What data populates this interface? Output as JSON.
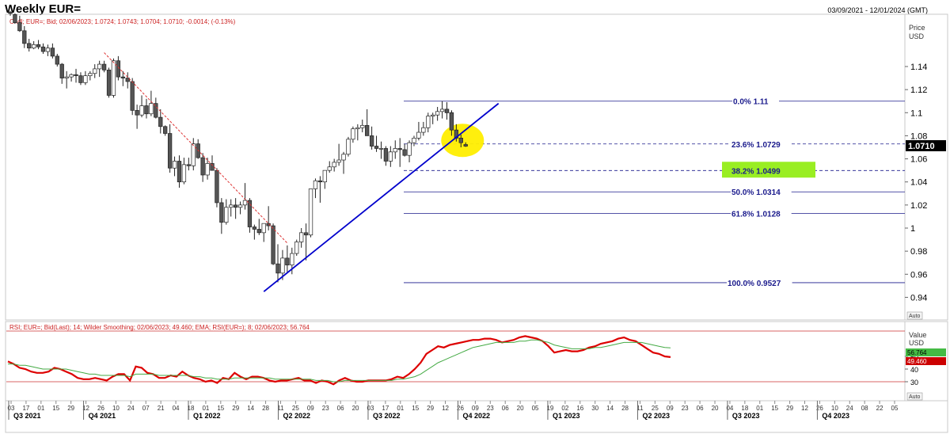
{
  "header": {
    "title": "Weekly EUR=",
    "date_range": "03/09/2021 - 12/01/2024 (GMT)"
  },
  "price_panel": {
    "legend": "Cndl; EUR=; Bid; 02/06/2023; 1.0724; 1.0743; 1.0704; 1.0710; -0.0014; (-0.13%)",
    "axis_title_1": "Price",
    "axis_title_2": "USD",
    "current_price_tag": "1.0710",
    "auto_label": "Auto"
  },
  "rsi_panel": {
    "legend": "RSI; EUR=; Bid(Last); 14; Wilder Smoothing; 02/06/2023; 49.460; EMA; RSI(EUR=); 8; 02/06/2023; 56.764",
    "axis_title_1": "Value",
    "axis_title_2": "USD",
    "ema_tag": "56.764",
    "rsi_tag": "49.460",
    "auto_label": "Auto"
  },
  "colors": {
    "up_candle": "#ffffff",
    "down_candle": "#555555",
    "fib_line": "#1a1a8c",
    "fib_text": "#1a1a8c",
    "uptrend": "#0000cc",
    "downtrend": "#dd3333",
    "highlight_circle": "#ffee00",
    "fib_box": "#99ee22",
    "rsi_line": "#dd0000",
    "ema_line": "#44aa44",
    "rsi_bound": "#cc3333",
    "price_tag_bg": "#000000",
    "ema_tag_bg": "#44bb44",
    "rsi_tag_bg": "#cc0000"
  },
  "chart_data": [
    {
      "type": "candlestick",
      "title": "Weekly EUR=",
      "ylabel": "Price USD",
      "ylim": [
        0.925,
        1.155
      ],
      "yticks": [
        0.94,
        0.96,
        0.98,
        1,
        1.02,
        1.04,
        1.06,
        1.08,
        1.1,
        1.12,
        1.14
      ],
      "ytick_labels": [
        "0.94",
        "0.96",
        "0.98",
        "1",
        "1.02",
        "1.04",
        "1.06",
        "1.08",
        "1.1",
        "1.12",
        "1.14"
      ],
      "candles": [
        {
          "o": 1.187,
          "h": 1.188,
          "l": 1.184,
          "c": 1.186
        },
        {
          "o": 1.185,
          "h": 1.186,
          "l": 1.177,
          "c": 1.178
        },
        {
          "o": 1.178,
          "h": 1.184,
          "l": 1.17,
          "c": 1.171
        },
        {
          "o": 1.171,
          "h": 1.175,
          "l": 1.156,
          "c": 1.16
        },
        {
          "o": 1.16,
          "h": 1.164,
          "l": 1.153,
          "c": 1.156
        },
        {
          "o": 1.156,
          "h": 1.162,
          "l": 1.155,
          "c": 1.159
        },
        {
          "o": 1.159,
          "h": 1.163,
          "l": 1.155,
          "c": 1.157
        },
        {
          "o": 1.157,
          "h": 1.16,
          "l": 1.151,
          "c": 1.153
        },
        {
          "o": 1.153,
          "h": 1.159,
          "l": 1.149,
          "c": 1.156
        },
        {
          "o": 1.156,
          "h": 1.16,
          "l": 1.147,
          "c": 1.149
        },
        {
          "o": 1.149,
          "h": 1.151,
          "l": 1.14,
          "c": 1.142
        },
        {
          "o": 1.142,
          "h": 1.143,
          "l": 1.125,
          "c": 1.13
        },
        {
          "o": 1.13,
          "h": 1.136,
          "l": 1.121,
          "c": 1.131
        },
        {
          "o": 1.131,
          "h": 1.134,
          "l": 1.127,
          "c": 1.133
        },
        {
          "o": 1.133,
          "h": 1.138,
          "l": 1.126,
          "c": 1.132
        },
        {
          "o": 1.132,
          "h": 1.135,
          "l": 1.124,
          "c": 1.126
        },
        {
          "o": 1.126,
          "h": 1.136,
          "l": 1.124,
          "c": 1.132
        },
        {
          "o": 1.132,
          "h": 1.136,
          "l": 1.128,
          "c": 1.134
        },
        {
          "o": 1.134,
          "h": 1.142,
          "l": 1.13,
          "c": 1.138
        },
        {
          "o": 1.138,
          "h": 1.145,
          "l": 1.131,
          "c": 1.142
        },
        {
          "o": 1.142,
          "h": 1.145,
          "l": 1.135,
          "c": 1.137
        },
        {
          "o": 1.137,
          "h": 1.139,
          "l": 1.113,
          "c": 1.115
        },
        {
          "o": 1.115,
          "h": 1.147,
          "l": 1.113,
          "c": 1.145
        },
        {
          "o": 1.145,
          "h": 1.149,
          "l": 1.128,
          "c": 1.131
        },
        {
          "o": 1.131,
          "h": 1.136,
          "l": 1.123,
          "c": 1.13
        },
        {
          "o": 1.13,
          "h": 1.135,
          "l": 1.121,
          "c": 1.127
        },
        {
          "o": 1.127,
          "h": 1.13,
          "l": 1.098,
          "c": 1.102
        },
        {
          "o": 1.102,
          "h": 1.107,
          "l": 1.086,
          "c": 1.098
        },
        {
          "o": 1.098,
          "h": 1.115,
          "l": 1.096,
          "c": 1.106
        },
        {
          "o": 1.106,
          "h": 1.112,
          "l": 1.095,
          "c": 1.099
        },
        {
          "o": 1.099,
          "h": 1.119,
          "l": 1.097,
          "c": 1.108
        },
        {
          "o": 1.108,
          "h": 1.113,
          "l": 1.095,
          "c": 1.096
        },
        {
          "o": 1.096,
          "h": 1.103,
          "l": 1.082,
          "c": 1.088
        },
        {
          "o": 1.088,
          "h": 1.089,
          "l": 1.08,
          "c": 1.082
        },
        {
          "o": 1.082,
          "h": 1.09,
          "l": 1.048,
          "c": 1.052
        },
        {
          "o": 1.052,
          "h": 1.062,
          "l": 1.045,
          "c": 1.058
        },
        {
          "o": 1.058,
          "h": 1.063,
          "l": 1.035,
          "c": 1.04
        },
        {
          "o": 1.04,
          "h": 1.061,
          "l": 1.038,
          "c": 1.055
        },
        {
          "o": 1.055,
          "h": 1.061,
          "l": 1.05,
          "c": 1.054
        },
        {
          "o": 1.054,
          "h": 1.078,
          "l": 1.05,
          "c": 1.073
        },
        {
          "o": 1.073,
          "h": 1.077,
          "l": 1.06,
          "c": 1.061
        },
        {
          "o": 1.061,
          "h": 1.065,
          "l": 1.04,
          "c": 1.046
        },
        {
          "o": 1.046,
          "h": 1.061,
          "l": 1.042,
          "c": 1.056
        },
        {
          "o": 1.056,
          "h": 1.063,
          "l": 1.05,
          "c": 1.05
        },
        {
          "o": 1.05,
          "h": 1.052,
          "l": 1.018,
          "c": 1.022
        },
        {
          "o": 1.022,
          "h": 1.026,
          "l": 0.995,
          "c": 1.005
        },
        {
          "o": 1.005,
          "h": 1.025,
          "l": 1.003,
          "c": 1.018
        },
        {
          "o": 1.018,
          "h": 1.025,
          "l": 1.01,
          "c": 1.02
        },
        {
          "o": 1.02,
          "h": 1.026,
          "l": 1.008,
          "c": 1.018
        },
        {
          "o": 1.018,
          "h": 1.023,
          "l": 1.012,
          "c": 1.02
        },
        {
          "o": 1.02,
          "h": 1.039,
          "l": 1.016,
          "c": 1.024
        },
        {
          "o": 1.024,
          "h": 1.026,
          "l": 0.996,
          "c": 1.001
        },
        {
          "o": 1.001,
          "h": 1.003,
          "l": 0.99,
          "c": 0.999
        },
        {
          "o": 0.999,
          "h": 1.008,
          "l": 0.994,
          "c": 0.996
        },
        {
          "o": 0.996,
          "h": 1.004,
          "l": 0.988,
          "c": 1.004
        },
        {
          "o": 1.004,
          "h": 1.019,
          "l": 0.998,
          "c": 1.002
        },
        {
          "o": 1.002,
          "h": 1.004,
          "l": 0.968,
          "c": 0.969
        },
        {
          "o": 0.969,
          "h": 0.986,
          "l": 0.953,
          "c": 0.961
        },
        {
          "o": 0.961,
          "h": 0.981,
          "l": 0.955,
          "c": 0.974
        },
        {
          "o": 0.974,
          "h": 0.985,
          "l": 0.962,
          "c": 0.968
        },
        {
          "o": 0.968,
          "h": 0.983,
          "l": 0.96,
          "c": 0.978
        },
        {
          "o": 0.978,
          "h": 0.99,
          "l": 0.976,
          "c": 0.988
        },
        {
          "o": 0.988,
          "h": 1.0,
          "l": 0.983,
          "c": 0.996
        },
        {
          "o": 0.996,
          "h": 1.004,
          "l": 0.972,
          "c": 0.994
        },
        {
          "o": 0.994,
          "h": 1.034,
          "l": 0.992,
          "c": 1.034
        },
        {
          "o": 1.034,
          "h": 1.043,
          "l": 1.026,
          "c": 1.041
        },
        {
          "o": 1.041,
          "h": 1.045,
          "l": 1.022,
          "c": 1.04
        },
        {
          "o": 1.04,
          "h": 1.05,
          "l": 1.034,
          "c": 1.05
        },
        {
          "o": 1.05,
          "h": 1.058,
          "l": 1.048,
          "c": 1.053
        },
        {
          "o": 1.053,
          "h": 1.06,
          "l": 1.049,
          "c": 1.057
        },
        {
          "o": 1.057,
          "h": 1.073,
          "l": 1.054,
          "c": 1.059
        },
        {
          "o": 1.059,
          "h": 1.066,
          "l": 1.047,
          "c": 1.064
        },
        {
          "o": 1.064,
          "h": 1.079,
          "l": 1.062,
          "c": 1.077
        },
        {
          "o": 1.077,
          "h": 1.088,
          "l": 1.074,
          "c": 1.086
        },
        {
          "o": 1.086,
          "h": 1.09,
          "l": 1.076,
          "c": 1.087
        },
        {
          "o": 1.087,
          "h": 1.094,
          "l": 1.083,
          "c": 1.089
        },
        {
          "o": 1.089,
          "h": 1.103,
          "l": 1.083,
          "c": 1.08
        },
        {
          "o": 1.08,
          "h": 1.088,
          "l": 1.068,
          "c": 1.071
        },
        {
          "o": 1.071,
          "h": 1.08,
          "l": 1.066,
          "c": 1.069
        },
        {
          "o": 1.069,
          "h": 1.075,
          "l": 1.06,
          "c": 1.069
        },
        {
          "o": 1.069,
          "h": 1.071,
          "l": 1.054,
          "c": 1.058
        },
        {
          "o": 1.058,
          "h": 1.071,
          "l": 1.053,
          "c": 1.066
        },
        {
          "o": 1.066,
          "h": 1.076,
          "l": 1.06,
          "c": 1.069
        },
        {
          "o": 1.069,
          "h": 1.078,
          "l": 1.053,
          "c": 1.068
        },
        {
          "o": 1.068,
          "h": 1.073,
          "l": 1.062,
          "c": 1.063
        },
        {
          "o": 1.063,
          "h": 1.076,
          "l": 1.057,
          "c": 1.074
        },
        {
          "o": 1.074,
          "h": 1.08,
          "l": 1.071,
          "c": 1.078
        },
        {
          "o": 1.078,
          "h": 1.092,
          "l": 1.076,
          "c": 1.083
        },
        {
          "o": 1.083,
          "h": 1.092,
          "l": 1.08,
          "c": 1.087
        },
        {
          "o": 1.087,
          "h": 1.1,
          "l": 1.083,
          "c": 1.097
        },
        {
          "o": 1.097,
          "h": 1.1,
          "l": 1.09,
          "c": 1.098
        },
        {
          "o": 1.098,
          "h": 1.105,
          "l": 1.093,
          "c": 1.101
        },
        {
          "o": 1.101,
          "h": 1.11,
          "l": 1.095,
          "c": 1.103
        },
        {
          "o": 1.103,
          "h": 1.109,
          "l": 1.094,
          "c": 1.1
        },
        {
          "o": 1.1,
          "h": 1.102,
          "l": 1.08,
          "c": 1.085
        },
        {
          "o": 1.085,
          "h": 1.09,
          "l": 1.075,
          "c": 1.078
        },
        {
          "o": 1.078,
          "h": 1.081,
          "l": 1.07,
          "c": 1.074
        },
        {
          "o": 1.0724,
          "h": 1.0743,
          "l": 1.0704,
          "c": 1.071
        }
      ],
      "fibonacci": [
        {
          "pct": "0.0%",
          "value": "1.11",
          "level": 1.11
        },
        {
          "pct": "23.6%",
          "value": "1.0729",
          "level": 1.0729
        },
        {
          "pct": "38.2%",
          "value": "1.0499",
          "level": 1.0499
        },
        {
          "pct": "50.0%",
          "value": "1.0314",
          "level": 1.0314
        },
        {
          "pct": "61.8%",
          "value": "1.0128",
          "level": 1.0128
        },
        {
          "pct": "100.0%",
          "value": "0.9527",
          "level": 0.9527
        }
      ],
      "downtrend_line": {
        "from": {
          "bar": 20,
          "price": 1.152
        },
        "to": {
          "bar": 59,
          "price": 0.987
        }
      },
      "uptrend_line": {
        "from": {
          "bar": 54,
          "price": 0.945
        },
        "to": {
          "bar": 104,
          "price": 1.108
        }
      },
      "highlight": {
        "bar": 96,
        "price": 1.076
      }
    },
    {
      "type": "line",
      "title": "RSI",
      "ylabel": "Value USD",
      "ylim": [
        20,
        85
      ],
      "yticks": [
        30,
        40,
        50
      ],
      "ytick_labels": [
        "30",
        "40",
        "50"
      ],
      "bounds": [
        30,
        70
      ],
      "series": [
        {
          "name": "RSI",
          "values": [
            46,
            44,
            41,
            40,
            38,
            37,
            37,
            38,
            41,
            40,
            38,
            36,
            33,
            32,
            32,
            33,
            32,
            31,
            34,
            36,
            36,
            31,
            42,
            41,
            37,
            36,
            33,
            33,
            35,
            34,
            38,
            35,
            33,
            32,
            30,
            31,
            29,
            33,
            32,
            37,
            34,
            32,
            34,
            34,
            33,
            31,
            30,
            31,
            31,
            32,
            33,
            31,
            31,
            29,
            31,
            30,
            28,
            31,
            33,
            31,
            30,
            30,
            31,
            31,
            31,
            31,
            32,
            34,
            33,
            36,
            40,
            45,
            52,
            55,
            58,
            57,
            59,
            60,
            61,
            62,
            63,
            63,
            64,
            64,
            63,
            61,
            62,
            63,
            65,
            66,
            65,
            64,
            62,
            58,
            53,
            54,
            55,
            54,
            54,
            55,
            57,
            58,
            60,
            61,
            62,
            64,
            65,
            63,
            62,
            59,
            56,
            53,
            52,
            50,
            49.46
          ]
        },
        {
          "name": "EMA",
          "values": [
            44,
            44,
            43,
            43,
            42,
            41,
            40,
            40,
            40,
            40,
            40,
            39,
            38,
            37,
            36,
            36,
            35,
            35,
            35,
            35,
            35,
            34,
            36,
            36,
            36,
            36,
            35,
            35,
            35,
            35,
            35,
            35,
            34,
            34,
            33,
            33,
            32,
            32,
            32,
            33,
            33,
            33,
            33,
            33,
            33,
            33,
            32,
            32,
            32,
            32,
            32,
            32,
            32,
            31,
            31,
            31,
            30,
            30,
            31,
            31,
            31,
            31,
            31,
            31,
            31,
            31,
            31,
            32,
            32,
            33,
            34,
            36,
            39,
            42,
            45,
            47,
            49,
            51,
            53,
            55,
            57,
            58,
            59,
            60,
            61,
            61,
            61,
            61,
            62,
            62,
            63,
            63,
            62,
            61,
            59,
            58,
            57,
            56,
            56,
            56,
            56,
            57,
            57,
            58,
            59,
            60,
            61,
            61,
            61,
            61,
            60,
            59,
            58,
            57,
            56.764
          ]
        }
      ]
    },
    {
      "type": "axis",
      "x_ticks": [
        "03",
        "17",
        "01",
        "15",
        "29",
        "12",
        "26",
        "10",
        "24",
        "07",
        "21",
        "04",
        "18",
        "01",
        "15",
        "29",
        "14",
        "28",
        "11",
        "25",
        "09",
        "23",
        "06",
        "20",
        "03",
        "17",
        "01",
        "15",
        "29",
        "12",
        "26",
        "09",
        "23",
        "06",
        "20",
        "05",
        "19",
        "02",
        "16",
        "30",
        "14",
        "28",
        "11",
        "25",
        "09",
        "23",
        "06",
        "20",
        "04",
        "18",
        "01",
        "15",
        "29",
        "12",
        "26",
        "10",
        "24",
        "08",
        "22",
        "05"
      ],
      "x_tick_count": 60,
      "quarters": [
        "Q3 2021",
        "Q4 2021",
        "Q1 2022",
        "Q2 2022",
        "Q3 2022",
        "Q4 2022",
        "Q1 2023",
        "Q2 2023",
        "Q3 2023",
        "Q4 2023"
      ]
    }
  ]
}
